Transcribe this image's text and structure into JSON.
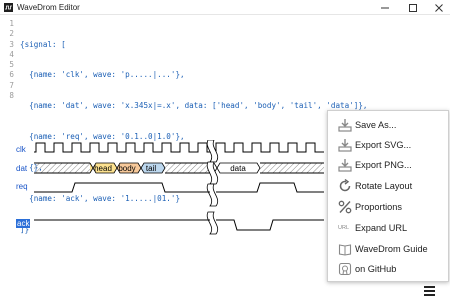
{
  "window": {
    "title": "WaveDrom Editor",
    "controls": [
      "minimize",
      "maximize",
      "close"
    ]
  },
  "editor": {
    "line_numbers": [
      "1",
      "2",
      "3",
      "4",
      "5",
      "6",
      "7",
      "8"
    ],
    "lines": [
      "{signal: [",
      "  {name: 'clk', wave: 'p.....|...'},",
      "  {name: 'dat', wave: 'x.345x|=.x', data: ['head', 'body', 'tail', 'data']},",
      "  {name: 'req', wave: '0.1..0|1.0'},",
      "  {},",
      "  {name: 'ack', wave: '1.....|01.'}",
      "]}",
      ""
    ]
  },
  "waveform": {
    "signals": [
      "clk",
      "dat",
      "req",
      "ack"
    ],
    "data_labels": [
      "head",
      "body",
      "tail",
      "data"
    ],
    "colors": {
      "label": "#1a55c8",
      "head": "#fde28f",
      "body": "#f7c99a",
      "tail": "#bcd7ee",
      "selected": "#2b6fd8"
    }
  },
  "menu": {
    "items": [
      {
        "label": "Save As...",
        "icon": "download-icon"
      },
      {
        "label": "Export SVG...",
        "icon": "download-icon"
      },
      {
        "label": "Export PNG...",
        "icon": "download-icon"
      },
      {
        "label": "Rotate Layout",
        "icon": "rotate-icon"
      },
      {
        "label": "Proportions",
        "icon": "percent-icon"
      },
      {
        "label": "Expand URL",
        "icon": "url-icon"
      },
      {
        "label": "WaveDrom Guide",
        "icon": "book-icon"
      },
      {
        "label": "on GitHub",
        "icon": "github-icon"
      }
    ],
    "url_icon_text": "URL"
  }
}
